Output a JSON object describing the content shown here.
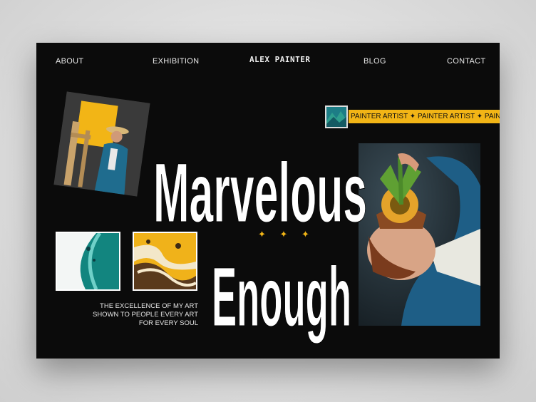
{
  "nav": {
    "about": "ABOUT",
    "exhibition": "EXHIBITION",
    "logo": "ALEX PAINTER",
    "blog": "BLOG",
    "contact": "CONTACT"
  },
  "hero": {
    "line1": "Marvelous",
    "line2": "Enough",
    "stars": "✦ ✦ ✦",
    "marquee": "PAINTER ARTIST  ✦  PAINTER ARTIST  ✦  PAINTER ARTIST",
    "tagline": [
      "THE EXCELLENCE OF MY ART",
      "SHOWN TO PEOPLE EVERY ART",
      "FOR EVERY SOUL"
    ]
  },
  "colors": {
    "accent": "#f2b516",
    "background": "#0b0b0b",
    "teal": "#1a8a8c"
  }
}
